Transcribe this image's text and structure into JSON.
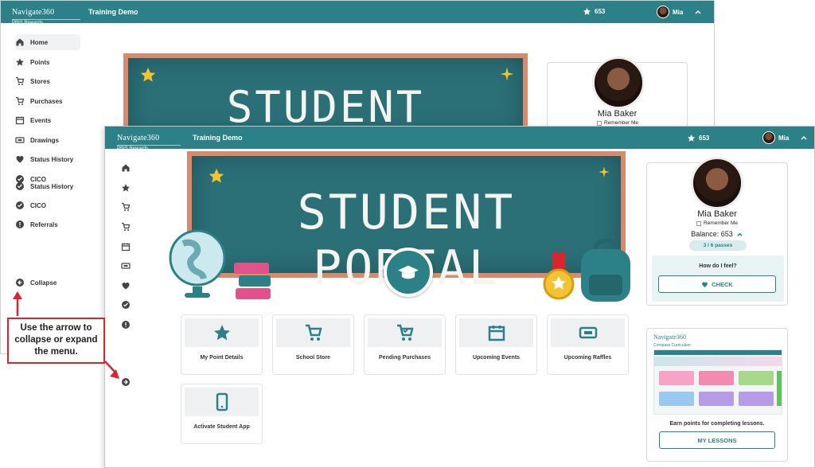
{
  "back_window": {
    "logo_brand": "Navigate360",
    "logo_sub": "PBIS Rewards",
    "app_title": "Training Demo",
    "points": "653",
    "user_name": "Mia",
    "sidebar": [
      {
        "label": "Home",
        "icon": "home-icon"
      },
      {
        "label": "Points",
        "icon": "star-icon"
      },
      {
        "label": "Stores",
        "icon": "cart-icon"
      },
      {
        "label": "Purchases",
        "icon": "cart-check-icon"
      },
      {
        "label": "Events",
        "icon": "calendar-icon"
      },
      {
        "label": "Drawings",
        "icon": "ticket-icon"
      },
      {
        "label": "Status History",
        "icon": "heart-icon"
      },
      {
        "label": "CICO",
        "icon": "check-circle-icon"
      },
      {
        "label": "Status History",
        "icon": "check-circle-icon"
      },
      {
        "label": "CICO",
        "icon": "check-circle-icon"
      },
      {
        "label": "Referrals",
        "icon": "alert-icon"
      }
    ],
    "collapse_label": "Collapse",
    "banner_title": "STUDENT PORTAL",
    "profile_name": "Mia Baker",
    "remember_me": "Remember Me"
  },
  "front_window": {
    "logo_brand": "Navigate360",
    "logo_sub": "PBIS Rewards",
    "app_title": "Training Demo",
    "points": "653",
    "user_name": "Mia",
    "banner_title": "STUDENT PORTAL",
    "tiles": [
      {
        "label": "My Point Details",
        "icon": "star-icon"
      },
      {
        "label": "School Store",
        "icon": "cart-icon"
      },
      {
        "label": "Pending Purchases",
        "icon": "cart-check-icon"
      },
      {
        "label": "Upcoming Events",
        "icon": "calendar-icon"
      },
      {
        "label": "Upcoming Raffles",
        "icon": "ticket-icon"
      },
      {
        "label": "Activate Student App",
        "icon": "phone-icon"
      }
    ],
    "profile": {
      "name": "Mia Baker",
      "remember_me": "Remember Me",
      "balance_label": "Balance: 653",
      "passes": "3 / 6 passes",
      "feel_question": "How do I feel?",
      "check_button": "CHECK"
    },
    "lessons": {
      "logo_brand": "Navigate360",
      "logo_sub": "Compass Curriculum",
      "caption": "Earn points for completing lessons.",
      "button": "MY LESSONS"
    }
  },
  "callout": {
    "text": "Use the arrow to collapse or expand the menu."
  },
  "colors": {
    "brand_teal": "#2c8188",
    "board_green": "#2b6f77",
    "board_frame": "#d98a6b",
    "callout_red": "#d8262f",
    "star_yellow": "#f4c430"
  }
}
